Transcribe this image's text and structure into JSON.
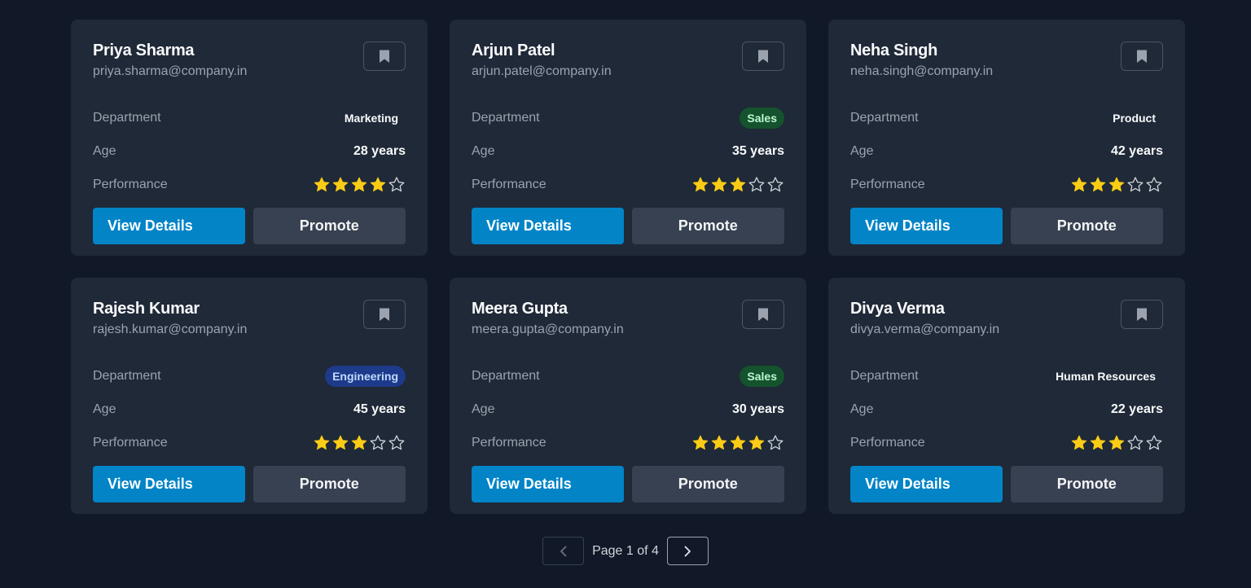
{
  "labels": {
    "department": "Department",
    "age": "Age",
    "performance": "Performance",
    "view_details": "View Details",
    "promote": "Promote"
  },
  "colors": {
    "accent": "#0284c7",
    "star_filled": "#facc15",
    "star_empty": "#d1d5db"
  },
  "employees": [
    {
      "name": "Priya Sharma",
      "email": "priya.sharma@company.in",
      "department": "Marketing",
      "badge_bg": "transparent",
      "badge_color": "#f9fafb",
      "age": "28 years",
      "rating": 4
    },
    {
      "name": "Arjun Patel",
      "email": "arjun.patel@company.in",
      "department": "Sales",
      "badge_bg": "#14532d",
      "badge_color": "#bbf7d0",
      "age": "35 years",
      "rating": 3
    },
    {
      "name": "Neha Singh",
      "email": "neha.singh@company.in",
      "department": "Product",
      "badge_bg": "transparent",
      "badge_color": "#f9fafb",
      "age": "42 years",
      "rating": 3
    },
    {
      "name": "Rajesh Kumar",
      "email": "rajesh.kumar@company.in",
      "department": "Engineering",
      "badge_bg": "#1e3a8a",
      "badge_color": "#bfdbfe",
      "age": "45 years",
      "rating": 3
    },
    {
      "name": "Meera Gupta",
      "email": "meera.gupta@company.in",
      "department": "Sales",
      "badge_bg": "#14532d",
      "badge_color": "#bbf7d0",
      "age": "30 years",
      "rating": 4
    },
    {
      "name": "Divya Verma",
      "email": "divya.verma@company.in",
      "department": "Human Resources",
      "badge_bg": "transparent",
      "badge_color": "#f9fafb",
      "age": "22 years",
      "rating": 3
    }
  ],
  "pagination": {
    "text": "Page 1 of 4",
    "prev_icon": "chevron-left-icon",
    "next_icon": "chevron-right-icon"
  }
}
